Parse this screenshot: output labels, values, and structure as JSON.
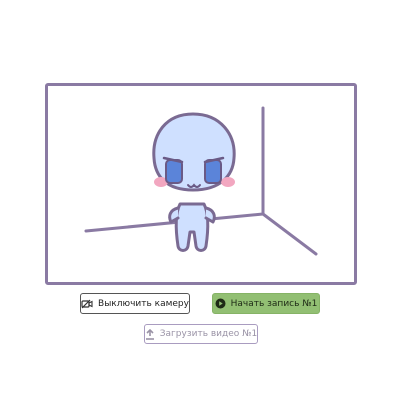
{
  "controls": {
    "camera_toggle_label": "Выключить камеру",
    "record_label": "Начать запись №1",
    "upload_label": "Загрузить видео №1"
  },
  "icons": {
    "camera": "camera-off-icon",
    "record": "record-dot-icon",
    "upload": "upload-arrow-icon"
  },
  "colors": {
    "frame_border": "#8a7aa3",
    "record_button": "#92bf73",
    "upload_border": "#a99cc0",
    "character_fill": "#cfe0ff",
    "eyes": "#5b84d9",
    "cheeks": "#f2a7c0"
  }
}
